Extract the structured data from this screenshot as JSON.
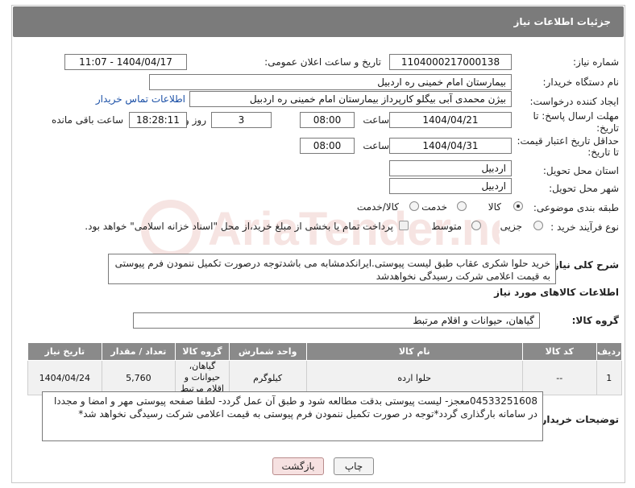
{
  "header": {
    "title": "جزئیات اطلاعات نیاز"
  },
  "fields": {
    "need_number_label": "شماره نیاز:",
    "need_number": "1104000217000138",
    "announce_label": "تاریخ و ساعت اعلان عمومی:",
    "announce_value": "1404/04/17 - 11:07",
    "buyer_org_label": "نام دستگاه خریدار:",
    "buyer_org": "بیمارستان امام خمینی  ره  اردبیل",
    "creator_label": "ایجاد کننده درخواست:",
    "creator": "بیژن محمدی آبی بیگلو کارپرداز بیمارستان امام خمینی  ره  اردبیل",
    "contact_link": "اطلاعات تماس خریدار",
    "deadline_label_1": "مهلت ارسال پاسخ: تا",
    "deadline_label_2": "تاریخ:",
    "deadline_date": "1404/04/21",
    "time_label": "ساعت",
    "deadline_time": "08:00",
    "days_value": "3",
    "days_label": "روز و",
    "remaining_time": "18:28:11",
    "remaining_label": "ساعت باقی مانده",
    "price_label_1": "حداقل تاریخ اعتبار قیمت:",
    "price_label_2": "تا تاریخ:",
    "price_date": "1404/04/31",
    "price_time": "08:00",
    "province_label": "استان محل تحویل:",
    "province": "اردبیل",
    "city_label": "شهر محل تحویل:",
    "city": "اردبیل",
    "category_label": "طبقه بندی موضوعی:",
    "category_options": [
      "کالا",
      "خدمت",
      "کالا/خدمت"
    ],
    "category_selected": "کالا",
    "process_label": "نوع فرآیند خرید :",
    "process_options": [
      "جزیی",
      "متوسط"
    ],
    "process_note": "پرداخت تمام یا بخشی از مبلغ خرید،از محل \"اسناد خزانه اسلامی\" خواهد بود."
  },
  "description": {
    "label": "شرح کلی نیاز:",
    "text": "خرید حلوا شکری عقاب طبق لیست پیوستی.ایرانکدمشابه می باشدتوجه درصورت تکمیل ننمودن فرم پیوستی به قیمت اعلامی شرکت رسیدگی نخواهدشد"
  },
  "goods_section": {
    "title": "اطلاعات کالاهای مورد نیاز",
    "group_label": "گروه کالا:",
    "group_value": "گیاهان، حیوانات و اقلام مرتبط"
  },
  "table": {
    "headers": [
      "ردیف",
      "کد کالا",
      "نام کالا",
      "واحد شمارش",
      "گروه کالا",
      "تعداد / مقدار",
      "تاریخ نیاز"
    ],
    "rows": [
      [
        "1",
        "--",
        "حلوا ارده",
        "کیلوگرم",
        "گیاهان، حیوانات و اقلام مرتبط",
        "5,760",
        "1404/04/24"
      ]
    ]
  },
  "buyer_notes": {
    "label": "توضیحات خریدار:",
    "text": "04533251608معجز- لیست پیوستی بدقت مطالعه شود و طبق آن عمل گردد- لطفا صفحه پیوستی مهر و امضا و مجددا در سامانه بارگذاری گردد*توجه در صورت تکمیل ننمودن فرم پیوستی به قیمت اعلامی شرکت رسیدگی نخواهد شد*"
  },
  "buttons": {
    "print": "چاپ",
    "back": "بازگشت"
  },
  "watermark": {
    "text": "AriaTender.neT"
  },
  "colors": {
    "header_bg": "#7b7b7b",
    "link": "#1a4fa6",
    "back_button": "#f6e1e1",
    "watermark": "#c0392b"
  }
}
